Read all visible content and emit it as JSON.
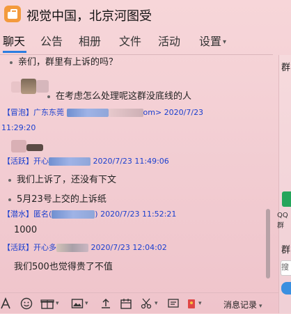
{
  "window": {
    "title": "视觉中国，北京河图受"
  },
  "tabs": [
    "聊天",
    "公告",
    "相册",
    "文件",
    "活动",
    "设置"
  ],
  "messages": [
    {
      "text": "亲们，群里有上诉的吗？"
    },
    {
      "text": "在考虑怎么处理呢这群没底线的人"
    },
    {
      "meta": "【冒泡】广东东莞 ",
      "meta2": "om> 2020/7/23",
      "meta3": "11:29:20"
    },
    {
      "meta": "【活跃】开心",
      "meta2": "2020/7/23 11:49:06"
    },
    {
      "text": "我们上诉了，还没有下文"
    },
    {
      "text": "5月23号上交的上诉纸"
    },
    {
      "meta": "【潜水】匿名(",
      "meta2": ") 2020/7/23 11:52:21"
    },
    {
      "text": "1000"
    },
    {
      "meta": "【活跃】开心多",
      "meta2": "2020/7/23 12:04:02"
    },
    {
      "text": "我们500也觉得贵了不值"
    }
  ],
  "right_panel": {
    "label1": "群",
    "label2": "群",
    "qq": "QQ群",
    "input": "搜"
  },
  "toolbar": {
    "history": "消息记录"
  },
  "colors": {
    "accent": "#2b7de1",
    "meta": "#1a3fcf"
  }
}
